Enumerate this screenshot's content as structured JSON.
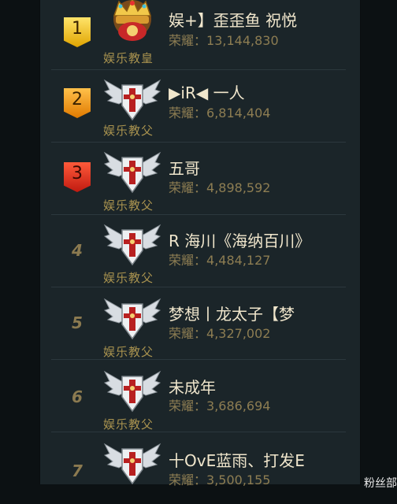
{
  "score_prefix": "荣耀：",
  "entries": [
    {
      "rank": "1",
      "name": "娱+】歪歪鱼 祝悦",
      "score": "13,144,830",
      "title": "娱乐教皇",
      "emblem": "crown-icon",
      "badge_color": "#e8b000"
    },
    {
      "rank": "2",
      "name": "▶iR◀ 一人",
      "score": "6,814,404",
      "title": "娱乐教父",
      "emblem": "winged-cross-icon",
      "badge_color": "#f08a00"
    },
    {
      "rank": "3",
      "name": "五哥",
      "score": "4,898,592",
      "title": "娱乐教父",
      "emblem": "winged-cross-icon",
      "badge_color": "#d82a18"
    },
    {
      "rank": "4",
      "name": "R 海川《海纳百川》",
      "score": "4,484,127",
      "title": "娱乐教父",
      "emblem": "winged-cross-icon"
    },
    {
      "rank": "5",
      "name": "梦想丨龙太子【梦",
      "score": "4,327,002",
      "title": "娱乐教父",
      "emblem": "winged-cross-icon"
    },
    {
      "rank": "6",
      "name": "未成年",
      "score": "3,686,694",
      "title": "娱乐教父",
      "emblem": "winged-cross-icon"
    },
    {
      "rank": "7",
      "name": "十OvE蓝雨、打发E",
      "score": "3,500,155",
      "title": "",
      "emblem": "winged-cross-icon"
    }
  ],
  "corner_text": "粉丝部"
}
